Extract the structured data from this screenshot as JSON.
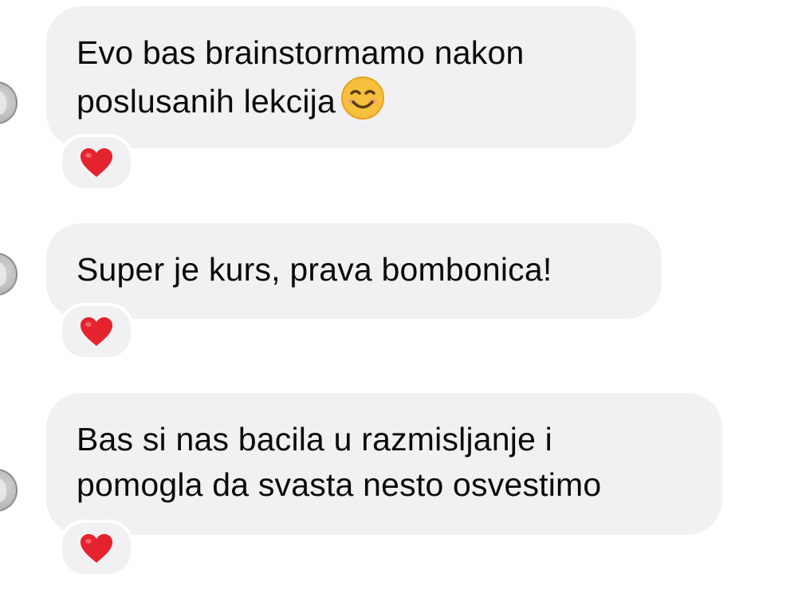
{
  "messages": [
    {
      "text": "Evo bas brainstormamo nakon\nposlusanih lekcija",
      "trailing_emoji": "smiling-face-emoji",
      "reaction": "red-heart-emoji"
    },
    {
      "text": "Super je kurs, prava bombonica!",
      "reaction": "red-heart-emoji"
    },
    {
      "text": "Bas si nas bacila u razmisljanje i\npomogla da svasta nesto osvestimo",
      "reaction": "red-heart-emoji"
    }
  ],
  "colors": {
    "bubble": "#f1f1f3",
    "text": "#0a0a0a",
    "heart": "#e4232e",
    "smile": "#f6b93b"
  }
}
